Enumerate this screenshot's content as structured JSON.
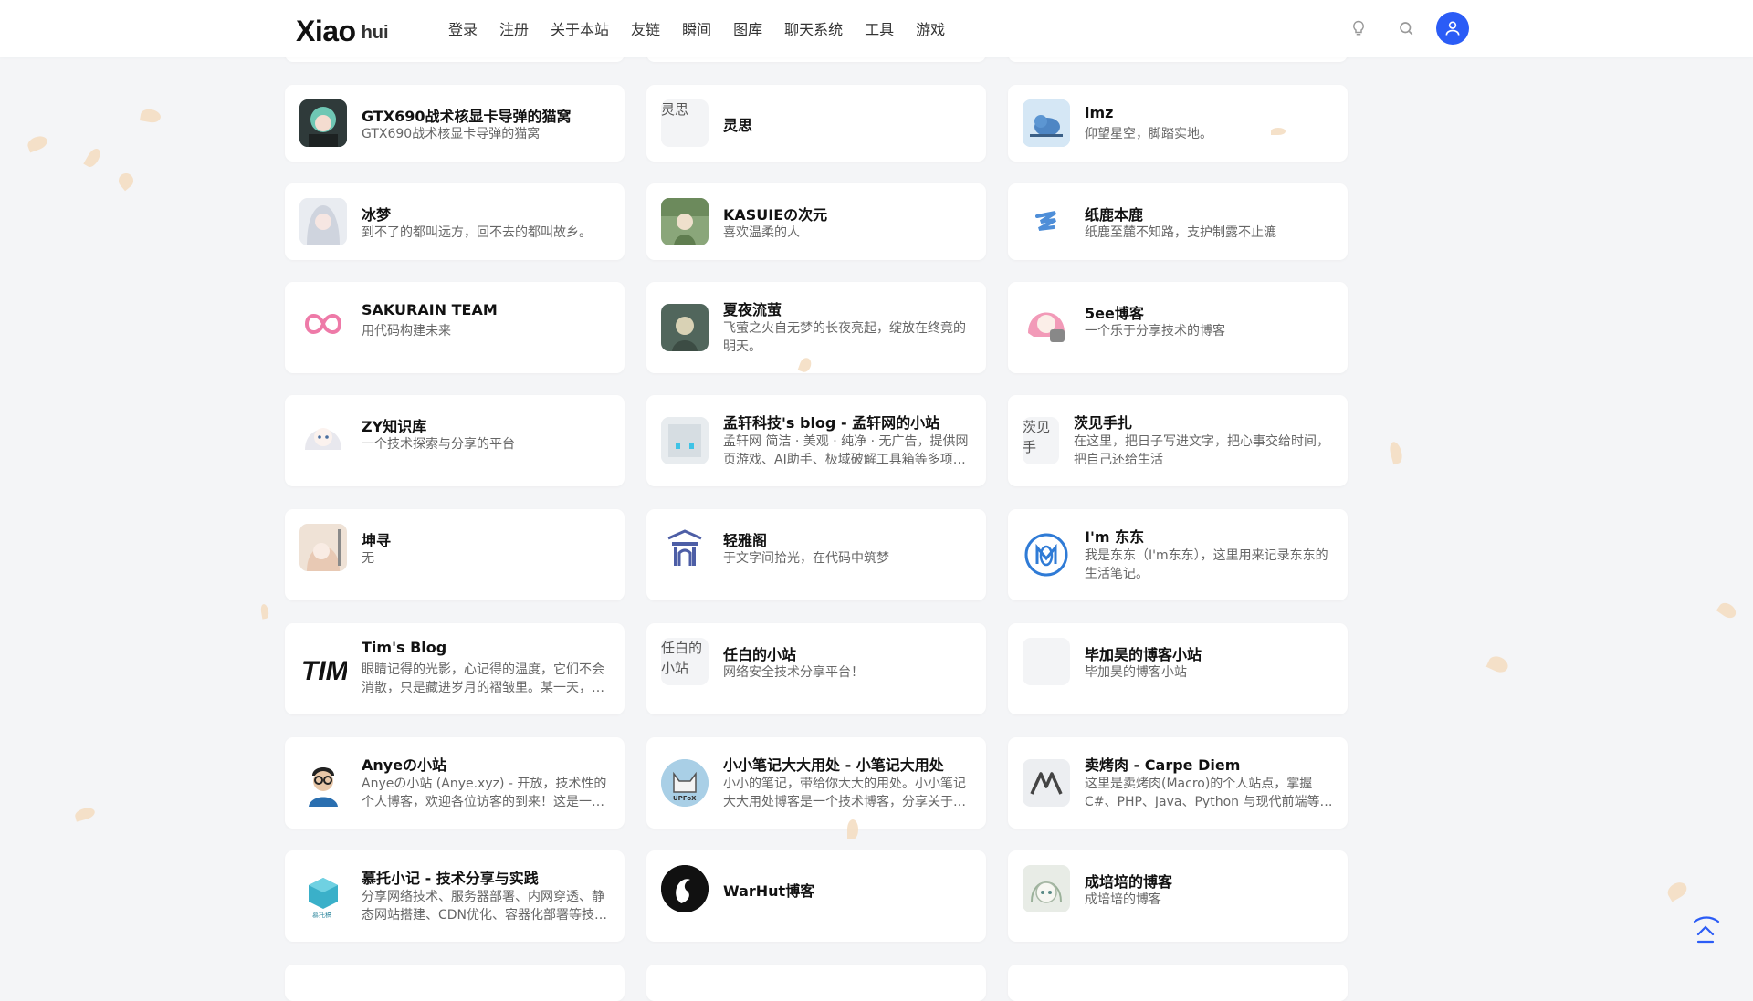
{
  "header": {
    "logo_main": "Xiao",
    "logo_sub": "hui",
    "nav": [
      "登录",
      "注册",
      "关于本站",
      "友链",
      "瞬间",
      "图库",
      "聊天系统",
      "工具",
      "游戏"
    ]
  },
  "colors": {
    "accent": "#2b5cf6",
    "card_bg": "#ffffff",
    "page_bg": "#f4f5f7"
  },
  "cards": [
    {
      "title": "GTX690战术核显卡导弹的猫窝",
      "desc": "GTX690战术核显卡导弹的猫窝",
      "icon": "anime-girl-avatar"
    },
    {
      "title": "灵思",
      "desc": "",
      "icon": "broken-image",
      "alt": "灵思"
    },
    {
      "title": "lmz",
      "desc": "仰望星空，脚踏实地。",
      "icon": "blue-bird-avatar"
    },
    {
      "title": "冰梦",
      "desc": "到不了的都叫远方，回不去的都叫故乡。",
      "icon": "white-hair-girl-avatar"
    },
    {
      "title": "KASUIEの次元",
      "desc": "喜欢温柔的人",
      "icon": "green-girl-avatar"
    },
    {
      "title": "纸鹿本鹿",
      "desc": "纸鹿至麓不知路，支护制露不止漉",
      "icon": "blue-stack-logo"
    },
    {
      "title": "SAKURAIN TEAM",
      "desc": "用代码构建未来",
      "icon": "pink-loop-logo"
    },
    {
      "title": "夏夜流萤",
      "desc": "飞萤之火自无梦的长夜亮起，绽放在终竟的明天。",
      "icon": "firefly-avatar"
    },
    {
      "title": "5ee博客",
      "desc": "一个乐于分享技术的博客",
      "icon": "pink-anime-avatar"
    },
    {
      "title": "ZY知识库",
      "desc": "一个技术探索与分享的平台",
      "icon": "white-anime-avatar"
    },
    {
      "title": "孟轩科技's blog - 孟轩网的小站",
      "desc": "孟轩网 简洁 · 美观 · 纯净 · 无广告，提供网页游戏、AI助手、极域破解工具箱等多项实用工具与资源",
      "icon": "pixel-face-avatar"
    },
    {
      "title": "茨见手扎",
      "desc": "在这里，把日子写进文字，把心事交给时间，把自己还给生活",
      "icon": "broken-image",
      "alt": "茨见手"
    },
    {
      "title": "坤寻",
      "desc": "无",
      "icon": "beige-anime-avatar"
    },
    {
      "title": "轻雅阁",
      "desc": "于文字间拾光，在代码中筑梦",
      "icon": "pavilion-logo"
    },
    {
      "title": "I'm 东东",
      "desc": "我是东东（I'm东东），这里用来记录东东的生活笔记。",
      "icon": "blue-circle-logo"
    },
    {
      "title": "Tim's Blog",
      "desc": "眼睛记得的光影，心记得的温度，它们不会消散，只是藏进岁月的褶皱里。某一天，偶然翻出",
      "icon": "tim-logo"
    },
    {
      "title": "任白的小站",
      "desc": "网络安全技术分享平台！",
      "icon": "broken-image",
      "alt": "任白的小站"
    },
    {
      "title": "毕加昊的博客小站",
      "desc": "毕加昊的博客小站",
      "icon": "blank-avatar"
    },
    {
      "title": "Anyeの小站",
      "desc": "Anyeの小站 (Anye.xyz) - 开放，技术性的个人博客，欢迎各位访客的到来！这是一个记录",
      "icon": "glasses-man-avatar"
    },
    {
      "title": "小小笔记大大用处 - 小笔记大用处",
      "desc": "小小的笔记，带给你大大的用处。小小笔记大大用处博客是一个技术博客，分享关于编程的",
      "icon": "upfox-avatar"
    },
    {
      "title": "卖烤肉 - Carpe Diem",
      "desc": "这里是卖烤肉(Macro)的个人站点，掌握 C#、PHP、Java、Python 与现代前端等多种技术",
      "icon": "m-logo"
    },
    {
      "title": "慕托小记 - 技术分享与实践",
      "desc": "分享网络技术、服务器部署、内网穿透、静态网站搭建、CDN优化、容器化部署等技术实践经验",
      "icon": "cube-logo"
    },
    {
      "title": "WarHut博客",
      "desc": "",
      "icon": "bird-circle-logo"
    },
    {
      "title": "成培培的博客",
      "desc": "成培培的博客",
      "icon": "sketch-avatar"
    }
  ]
}
